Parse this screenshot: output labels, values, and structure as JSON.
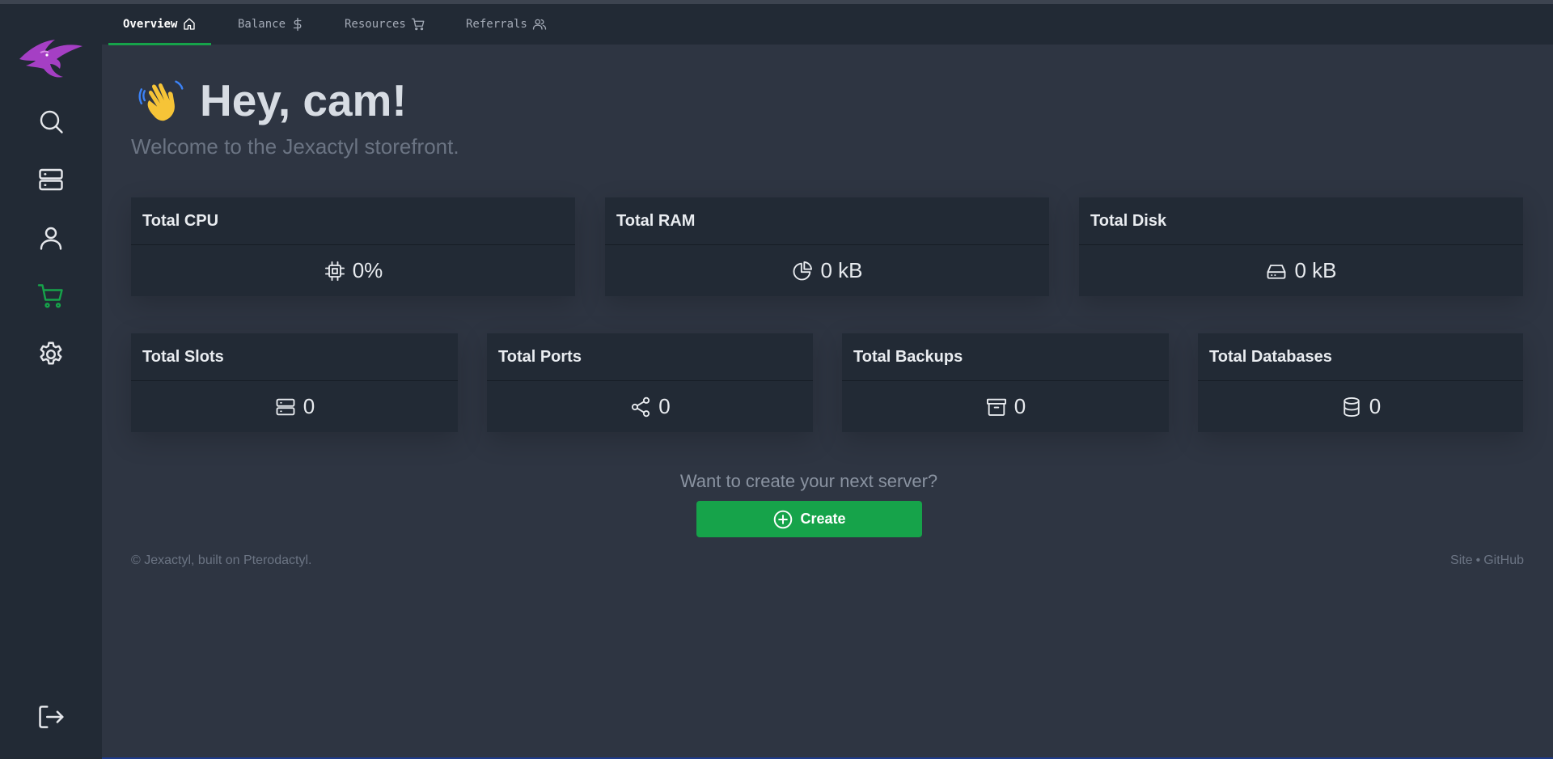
{
  "nav": {
    "tabs": [
      {
        "label": "Overview",
        "icon": "home-icon",
        "active": true
      },
      {
        "label": "Balance",
        "icon": "dollar-icon",
        "active": false
      },
      {
        "label": "Resources",
        "icon": "cart-icon",
        "active": false
      },
      {
        "label": "Referrals",
        "icon": "users-icon",
        "active": false
      }
    ]
  },
  "sidebar": {
    "items": [
      {
        "icon": "search-icon"
      },
      {
        "icon": "server-icon"
      },
      {
        "icon": "user-icon"
      },
      {
        "icon": "cart-icon",
        "active": true
      },
      {
        "icon": "gear-icon"
      }
    ],
    "logout_icon": "logout-icon"
  },
  "header": {
    "greeting": "Hey, cam!",
    "subtitle": "Welcome to the Jexactyl storefront."
  },
  "stats": {
    "row1": [
      {
        "title": "Total CPU",
        "value": "0%",
        "icon": "cpu-icon"
      },
      {
        "title": "Total RAM",
        "value": "0 kB",
        "icon": "pie-icon"
      },
      {
        "title": "Total Disk",
        "value": "0 kB",
        "icon": "disk-icon"
      }
    ],
    "row2": [
      {
        "title": "Total Slots",
        "value": "0",
        "icon": "server-icon"
      },
      {
        "title": "Total Ports",
        "value": "0",
        "icon": "share-icon"
      },
      {
        "title": "Total Backups",
        "value": "0",
        "icon": "archive-icon"
      },
      {
        "title": "Total Databases",
        "value": "0",
        "icon": "database-icon"
      }
    ]
  },
  "cta": {
    "prompt": "Want to create your next server?",
    "button": "Create"
  },
  "footer": {
    "left": "© Jexactyl, built on Pterodactyl.",
    "site": "Site",
    "separator": "•",
    "github": "GitHub"
  },
  "colors": {
    "accent": "#16a34a",
    "background": "#2e3542",
    "panel": "#222a35",
    "logo": "#a53fc4"
  }
}
